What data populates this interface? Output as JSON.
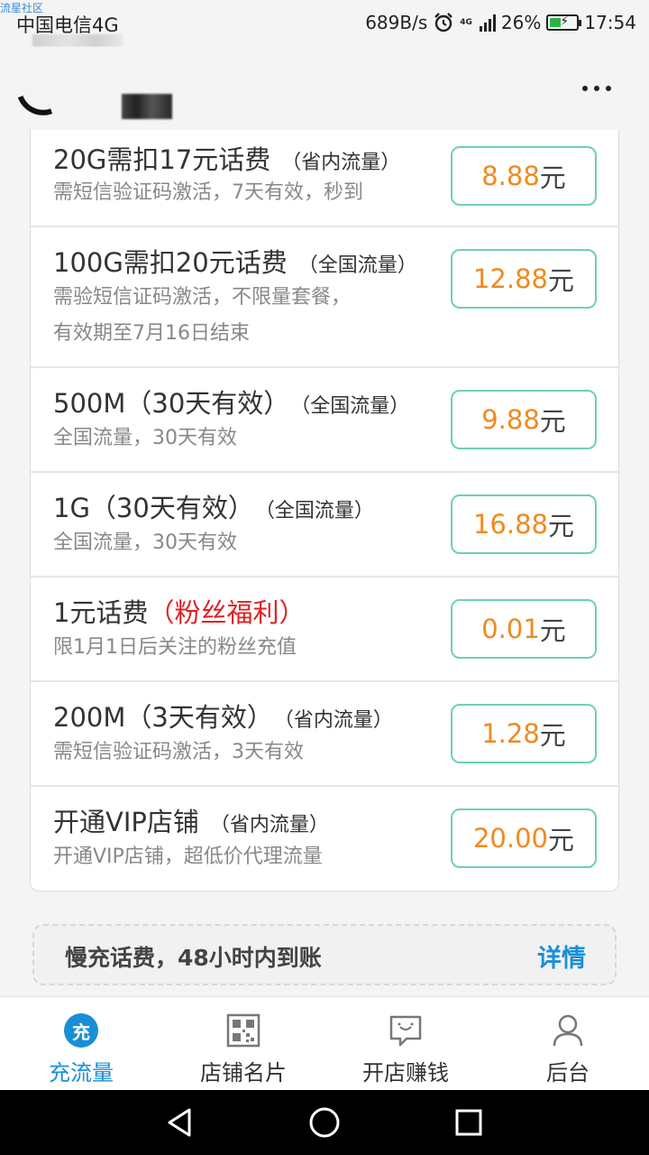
{
  "status_bar": {
    "watermark": "流星社区",
    "carrier": "中国电信4G",
    "speed": "689B/s",
    "network_label": "4G",
    "battery": "26%",
    "time": "17:54"
  },
  "products": [
    {
      "title": "20G需扣17元话费",
      "tag": "（省内流量）",
      "desc": [
        "需短信验证码激活，7天有效，秒到"
      ],
      "price": "8.88",
      "unit": "元"
    },
    {
      "title": "100G需扣20元话费",
      "tag": "（全国流量）",
      "desc": [
        "需验短信证码激活，不限量套餐，",
        "有效期至7月16日结束"
      ],
      "price": "12.88",
      "unit": "元"
    },
    {
      "title": "500M（30天有效）",
      "tag": "（全国流量）",
      "desc": [
        "全国流量，30天有效"
      ],
      "price": "9.88",
      "unit": "元"
    },
    {
      "title": "1G（30天有效）",
      "tag": "（全国流量）",
      "desc": [
        "全国流量，30天有效"
      ],
      "price": "16.88",
      "unit": "元"
    },
    {
      "title": "1元话费",
      "tag": "（粉丝福利）",
      "tag_color": "#e02020",
      "desc": [
        "限1月1日后关注的粉丝充值"
      ],
      "price": "0.01",
      "unit": "元"
    },
    {
      "title": "200M（3天有效）",
      "tag": "（省内流量）",
      "desc": [
        "需短信验证码激活，3天有效"
      ],
      "price": "1.28",
      "unit": "元"
    },
    {
      "title": "开通VIP店铺",
      "tag": "（省内流量）",
      "desc": [
        "开通VIP店铺，超低价代理流量"
      ],
      "price": "20.00",
      "unit": "元"
    }
  ],
  "notice": {
    "text": "慢充话费，48小时内到账",
    "link": "详情"
  },
  "tabs": [
    {
      "label": "充流量",
      "icon": "charge-icon",
      "icon_text": "充",
      "active": true
    },
    {
      "label": "店铺名片",
      "icon": "qr-code-icon"
    },
    {
      "label": "开店赚钱",
      "icon": "chat-bubble-icon"
    },
    {
      "label": "后台",
      "icon": "user-icon"
    }
  ],
  "colors": {
    "accent": "#1a8fd6",
    "price": "#f08a1e",
    "button_border": "#6fd0b2",
    "highlight": "#e02020"
  }
}
